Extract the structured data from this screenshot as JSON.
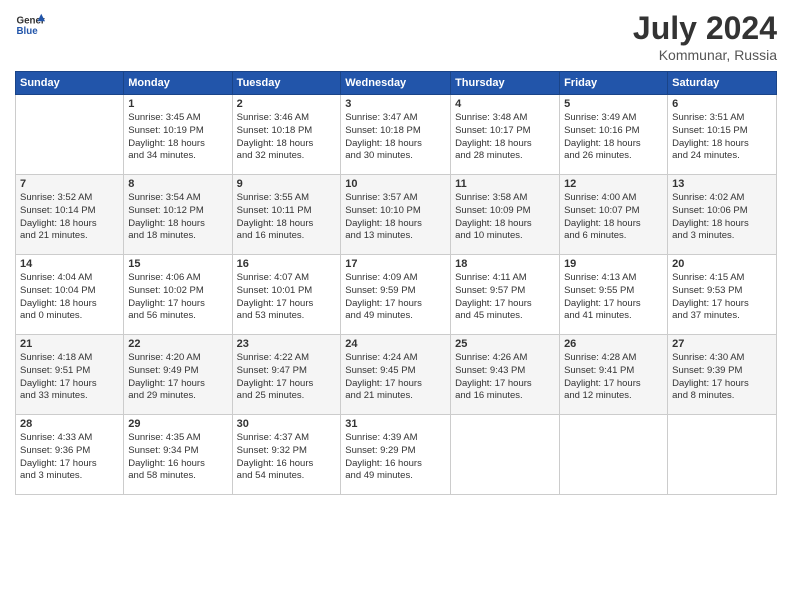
{
  "header": {
    "logo_general": "General",
    "logo_blue": "Blue",
    "month_year": "July 2024",
    "location": "Kommunar, Russia"
  },
  "days_of_week": [
    "Sunday",
    "Monday",
    "Tuesday",
    "Wednesday",
    "Thursday",
    "Friday",
    "Saturday"
  ],
  "weeks": [
    [
      {
        "day": "",
        "info": ""
      },
      {
        "day": "1",
        "info": "Sunrise: 3:45 AM\nSunset: 10:19 PM\nDaylight: 18 hours\nand 34 minutes."
      },
      {
        "day": "2",
        "info": "Sunrise: 3:46 AM\nSunset: 10:18 PM\nDaylight: 18 hours\nand 32 minutes."
      },
      {
        "day": "3",
        "info": "Sunrise: 3:47 AM\nSunset: 10:18 PM\nDaylight: 18 hours\nand 30 minutes."
      },
      {
        "day": "4",
        "info": "Sunrise: 3:48 AM\nSunset: 10:17 PM\nDaylight: 18 hours\nand 28 minutes."
      },
      {
        "day": "5",
        "info": "Sunrise: 3:49 AM\nSunset: 10:16 PM\nDaylight: 18 hours\nand 26 minutes."
      },
      {
        "day": "6",
        "info": "Sunrise: 3:51 AM\nSunset: 10:15 PM\nDaylight: 18 hours\nand 24 minutes."
      }
    ],
    [
      {
        "day": "7",
        "info": "Sunrise: 3:52 AM\nSunset: 10:14 PM\nDaylight: 18 hours\nand 21 minutes."
      },
      {
        "day": "8",
        "info": "Sunrise: 3:54 AM\nSunset: 10:12 PM\nDaylight: 18 hours\nand 18 minutes."
      },
      {
        "day": "9",
        "info": "Sunrise: 3:55 AM\nSunset: 10:11 PM\nDaylight: 18 hours\nand 16 minutes."
      },
      {
        "day": "10",
        "info": "Sunrise: 3:57 AM\nSunset: 10:10 PM\nDaylight: 18 hours\nand 13 minutes."
      },
      {
        "day": "11",
        "info": "Sunrise: 3:58 AM\nSunset: 10:09 PM\nDaylight: 18 hours\nand 10 minutes."
      },
      {
        "day": "12",
        "info": "Sunrise: 4:00 AM\nSunset: 10:07 PM\nDaylight: 18 hours\nand 6 minutes."
      },
      {
        "day": "13",
        "info": "Sunrise: 4:02 AM\nSunset: 10:06 PM\nDaylight: 18 hours\nand 3 minutes."
      }
    ],
    [
      {
        "day": "14",
        "info": "Sunrise: 4:04 AM\nSunset: 10:04 PM\nDaylight: 18 hours\nand 0 minutes."
      },
      {
        "day": "15",
        "info": "Sunrise: 4:06 AM\nSunset: 10:02 PM\nDaylight: 17 hours\nand 56 minutes."
      },
      {
        "day": "16",
        "info": "Sunrise: 4:07 AM\nSunset: 10:01 PM\nDaylight: 17 hours\nand 53 minutes."
      },
      {
        "day": "17",
        "info": "Sunrise: 4:09 AM\nSunset: 9:59 PM\nDaylight: 17 hours\nand 49 minutes."
      },
      {
        "day": "18",
        "info": "Sunrise: 4:11 AM\nSunset: 9:57 PM\nDaylight: 17 hours\nand 45 minutes."
      },
      {
        "day": "19",
        "info": "Sunrise: 4:13 AM\nSunset: 9:55 PM\nDaylight: 17 hours\nand 41 minutes."
      },
      {
        "day": "20",
        "info": "Sunrise: 4:15 AM\nSunset: 9:53 PM\nDaylight: 17 hours\nand 37 minutes."
      }
    ],
    [
      {
        "day": "21",
        "info": "Sunrise: 4:18 AM\nSunset: 9:51 PM\nDaylight: 17 hours\nand 33 minutes."
      },
      {
        "day": "22",
        "info": "Sunrise: 4:20 AM\nSunset: 9:49 PM\nDaylight: 17 hours\nand 29 minutes."
      },
      {
        "day": "23",
        "info": "Sunrise: 4:22 AM\nSunset: 9:47 PM\nDaylight: 17 hours\nand 25 minutes."
      },
      {
        "day": "24",
        "info": "Sunrise: 4:24 AM\nSunset: 9:45 PM\nDaylight: 17 hours\nand 21 minutes."
      },
      {
        "day": "25",
        "info": "Sunrise: 4:26 AM\nSunset: 9:43 PM\nDaylight: 17 hours\nand 16 minutes."
      },
      {
        "day": "26",
        "info": "Sunrise: 4:28 AM\nSunset: 9:41 PM\nDaylight: 17 hours\nand 12 minutes."
      },
      {
        "day": "27",
        "info": "Sunrise: 4:30 AM\nSunset: 9:39 PM\nDaylight: 17 hours\nand 8 minutes."
      }
    ],
    [
      {
        "day": "28",
        "info": "Sunrise: 4:33 AM\nSunset: 9:36 PM\nDaylight: 17 hours\nand 3 minutes."
      },
      {
        "day": "29",
        "info": "Sunrise: 4:35 AM\nSunset: 9:34 PM\nDaylight: 16 hours\nand 58 minutes."
      },
      {
        "day": "30",
        "info": "Sunrise: 4:37 AM\nSunset: 9:32 PM\nDaylight: 16 hours\nand 54 minutes."
      },
      {
        "day": "31",
        "info": "Sunrise: 4:39 AM\nSunset: 9:29 PM\nDaylight: 16 hours\nand 49 minutes."
      },
      {
        "day": "",
        "info": ""
      },
      {
        "day": "",
        "info": ""
      },
      {
        "day": "",
        "info": ""
      }
    ]
  ]
}
